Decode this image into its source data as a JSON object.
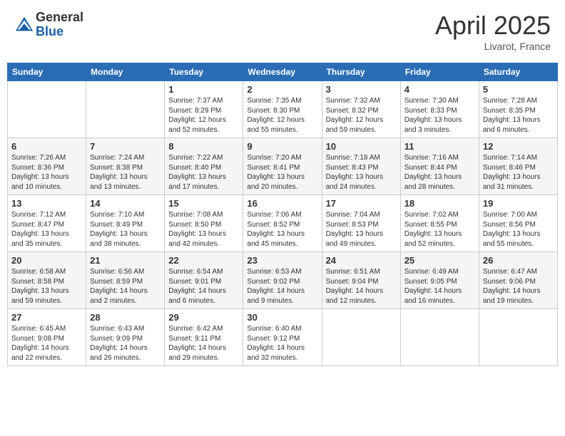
{
  "header": {
    "logo_general": "General",
    "logo_blue": "Blue",
    "month_title": "April 2025",
    "location": "Livarot, France"
  },
  "calendar": {
    "days_of_week": [
      "Sunday",
      "Monday",
      "Tuesday",
      "Wednesday",
      "Thursday",
      "Friday",
      "Saturday"
    ],
    "weeks": [
      [
        {
          "day": "",
          "sunrise": "",
          "sunset": "",
          "daylight": ""
        },
        {
          "day": "",
          "sunrise": "",
          "sunset": "",
          "daylight": ""
        },
        {
          "day": "1",
          "sunrise": "Sunrise: 7:37 AM",
          "sunset": "Sunset: 8:29 PM",
          "daylight": "Daylight: 12 hours and 52 minutes."
        },
        {
          "day": "2",
          "sunrise": "Sunrise: 7:35 AM",
          "sunset": "Sunset: 8:30 PM",
          "daylight": "Daylight: 12 hours and 55 minutes."
        },
        {
          "day": "3",
          "sunrise": "Sunrise: 7:32 AM",
          "sunset": "Sunset: 8:32 PM",
          "daylight": "Daylight: 12 hours and 59 minutes."
        },
        {
          "day": "4",
          "sunrise": "Sunrise: 7:30 AM",
          "sunset": "Sunset: 8:33 PM",
          "daylight": "Daylight: 13 hours and 3 minutes."
        },
        {
          "day": "5",
          "sunrise": "Sunrise: 7:28 AM",
          "sunset": "Sunset: 8:35 PM",
          "daylight": "Daylight: 13 hours and 6 minutes."
        }
      ],
      [
        {
          "day": "6",
          "sunrise": "Sunrise: 7:26 AM",
          "sunset": "Sunset: 8:36 PM",
          "daylight": "Daylight: 13 hours and 10 minutes."
        },
        {
          "day": "7",
          "sunrise": "Sunrise: 7:24 AM",
          "sunset": "Sunset: 8:38 PM",
          "daylight": "Daylight: 13 hours and 13 minutes."
        },
        {
          "day": "8",
          "sunrise": "Sunrise: 7:22 AM",
          "sunset": "Sunset: 8:40 PM",
          "daylight": "Daylight: 13 hours and 17 minutes."
        },
        {
          "day": "9",
          "sunrise": "Sunrise: 7:20 AM",
          "sunset": "Sunset: 8:41 PM",
          "daylight": "Daylight: 13 hours and 20 minutes."
        },
        {
          "day": "10",
          "sunrise": "Sunrise: 7:18 AM",
          "sunset": "Sunset: 8:43 PM",
          "daylight": "Daylight: 13 hours and 24 minutes."
        },
        {
          "day": "11",
          "sunrise": "Sunrise: 7:16 AM",
          "sunset": "Sunset: 8:44 PM",
          "daylight": "Daylight: 13 hours and 28 minutes."
        },
        {
          "day": "12",
          "sunrise": "Sunrise: 7:14 AM",
          "sunset": "Sunset: 8:46 PM",
          "daylight": "Daylight: 13 hours and 31 minutes."
        }
      ],
      [
        {
          "day": "13",
          "sunrise": "Sunrise: 7:12 AM",
          "sunset": "Sunset: 8:47 PM",
          "daylight": "Daylight: 13 hours and 35 minutes."
        },
        {
          "day": "14",
          "sunrise": "Sunrise: 7:10 AM",
          "sunset": "Sunset: 8:49 PM",
          "daylight": "Daylight: 13 hours and 38 minutes."
        },
        {
          "day": "15",
          "sunrise": "Sunrise: 7:08 AM",
          "sunset": "Sunset: 8:50 PM",
          "daylight": "Daylight: 13 hours and 42 minutes."
        },
        {
          "day": "16",
          "sunrise": "Sunrise: 7:06 AM",
          "sunset": "Sunset: 8:52 PM",
          "daylight": "Daylight: 13 hours and 45 minutes."
        },
        {
          "day": "17",
          "sunrise": "Sunrise: 7:04 AM",
          "sunset": "Sunset: 8:53 PM",
          "daylight": "Daylight: 13 hours and 49 minutes."
        },
        {
          "day": "18",
          "sunrise": "Sunrise: 7:02 AM",
          "sunset": "Sunset: 8:55 PM",
          "daylight": "Daylight: 13 hours and 52 minutes."
        },
        {
          "day": "19",
          "sunrise": "Sunrise: 7:00 AM",
          "sunset": "Sunset: 8:56 PM",
          "daylight": "Daylight: 13 hours and 55 minutes."
        }
      ],
      [
        {
          "day": "20",
          "sunrise": "Sunrise: 6:58 AM",
          "sunset": "Sunset: 8:58 PM",
          "daylight": "Daylight: 13 hours and 59 minutes."
        },
        {
          "day": "21",
          "sunrise": "Sunrise: 6:56 AM",
          "sunset": "Sunset: 8:59 PM",
          "daylight": "Daylight: 14 hours and 2 minutes."
        },
        {
          "day": "22",
          "sunrise": "Sunrise: 6:54 AM",
          "sunset": "Sunset: 9:01 PM",
          "daylight": "Daylight: 14 hours and 6 minutes."
        },
        {
          "day": "23",
          "sunrise": "Sunrise: 6:53 AM",
          "sunset": "Sunset: 9:02 PM",
          "daylight": "Daylight: 14 hours and 9 minutes."
        },
        {
          "day": "24",
          "sunrise": "Sunrise: 6:51 AM",
          "sunset": "Sunset: 9:04 PM",
          "daylight": "Daylight: 14 hours and 12 minutes."
        },
        {
          "day": "25",
          "sunrise": "Sunrise: 6:49 AM",
          "sunset": "Sunset: 9:05 PM",
          "daylight": "Daylight: 14 hours and 16 minutes."
        },
        {
          "day": "26",
          "sunrise": "Sunrise: 6:47 AM",
          "sunset": "Sunset: 9:06 PM",
          "daylight": "Daylight: 14 hours and 19 minutes."
        }
      ],
      [
        {
          "day": "27",
          "sunrise": "Sunrise: 6:45 AM",
          "sunset": "Sunset: 9:08 PM",
          "daylight": "Daylight: 14 hours and 22 minutes."
        },
        {
          "day": "28",
          "sunrise": "Sunrise: 6:43 AM",
          "sunset": "Sunset: 9:09 PM",
          "daylight": "Daylight: 14 hours and 26 minutes."
        },
        {
          "day": "29",
          "sunrise": "Sunrise: 6:42 AM",
          "sunset": "Sunset: 9:11 PM",
          "daylight": "Daylight: 14 hours and 29 minutes."
        },
        {
          "day": "30",
          "sunrise": "Sunrise: 6:40 AM",
          "sunset": "Sunset: 9:12 PM",
          "daylight": "Daylight: 14 hours and 32 minutes."
        },
        {
          "day": "",
          "sunrise": "",
          "sunset": "",
          "daylight": ""
        },
        {
          "day": "",
          "sunrise": "",
          "sunset": "",
          "daylight": ""
        },
        {
          "day": "",
          "sunrise": "",
          "sunset": "",
          "daylight": ""
        }
      ]
    ]
  }
}
